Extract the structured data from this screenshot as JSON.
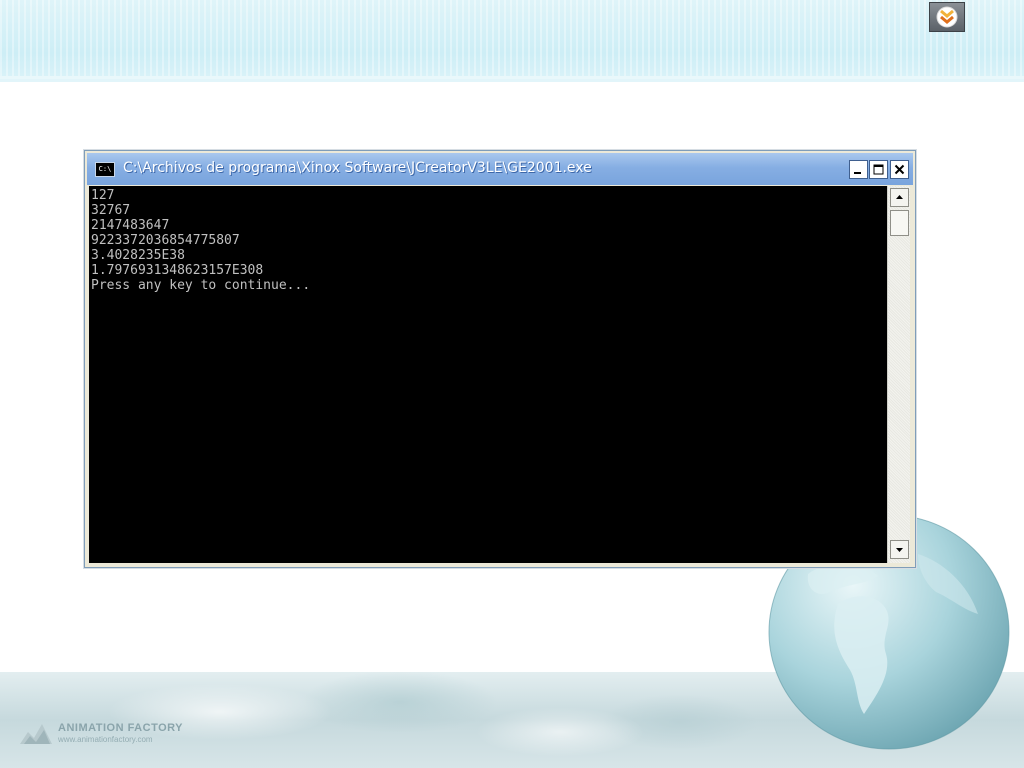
{
  "window": {
    "title": "C:\\Archivos de programa\\Xinox Software\\JCreatorV3LE\\GE2001.exe",
    "icon_label": "C:\\"
  },
  "console": {
    "lines": [
      "127",
      "32767",
      "2147483647",
      "9223372036854775807",
      "3.4028235E38",
      "1.7976931348623157E308",
      "Press any key to continue..."
    ],
    "text_color": "#c0c0c0",
    "background": "#000000"
  },
  "branding": {
    "name": "ANIMATION FACTORY",
    "url": "www.animationfactory.com"
  },
  "icons": {
    "nav": "double-chevron-down-icon",
    "minimize": "minimize-icon",
    "maximize": "maximize-icon",
    "close": "close-icon",
    "scroll_up": "arrow-up-icon",
    "scroll_down": "arrow-down-icon"
  },
  "colors": {
    "titlebar": "#86aee3",
    "nav_chevron_top": "#f2d23a",
    "nav_chevron_bottom": "#e07a1c"
  }
}
